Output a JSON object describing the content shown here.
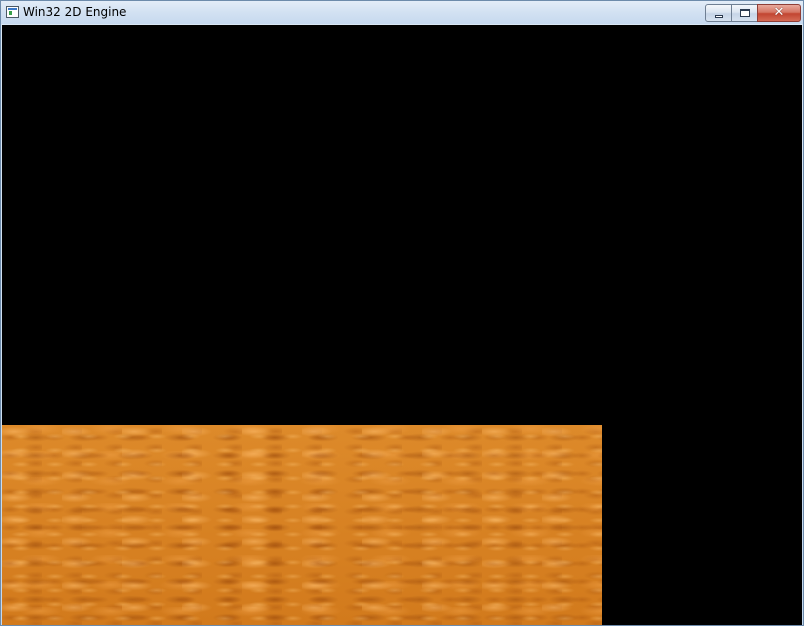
{
  "window": {
    "title": "Win32 2D Engine",
    "icon": "app-window-icon",
    "buttons": {
      "minimize": "minimize-icon",
      "maximize": "maximize-icon",
      "close": "close-icon",
      "close_glyph": "✕"
    }
  },
  "canvas": {
    "background_color": "#000000",
    "sprite": {
      "texture": "orange-marble-texture",
      "color": "#d8801e"
    }
  }
}
